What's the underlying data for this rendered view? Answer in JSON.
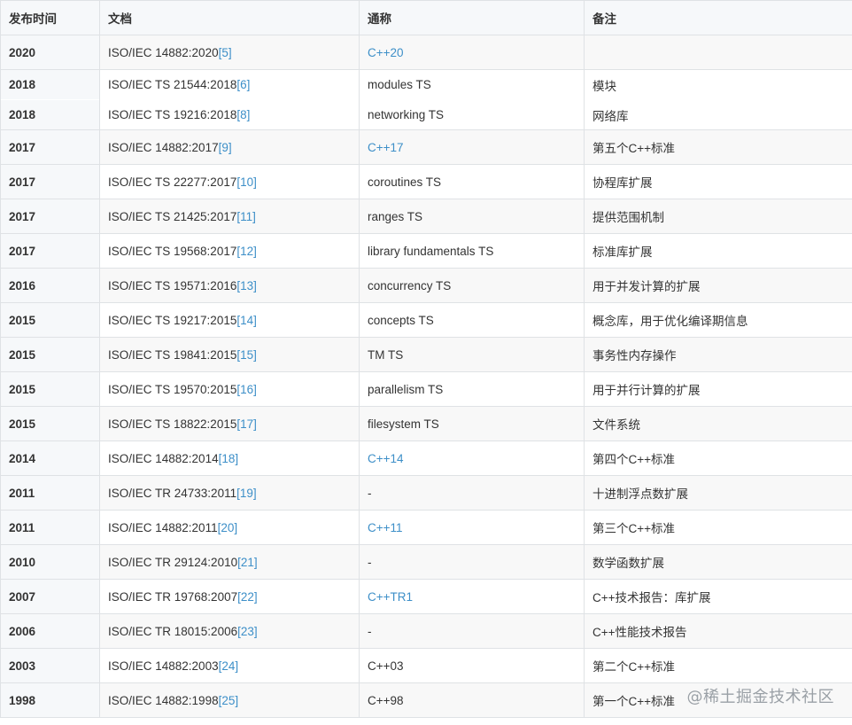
{
  "headers": [
    "发布时间",
    "文档",
    "通称",
    "备注"
  ],
  "rows": [
    {
      "year": "2020",
      "doc": "ISO/IEC 14882:2020",
      "ref": "[5]",
      "name": "C++20",
      "name_link": true,
      "note": ""
    },
    {
      "year": "2018",
      "doc": "ISO/IEC TS 21544:2018",
      "ref": "[6]",
      "name": "modules TS",
      "name_link": false,
      "note": "模块"
    },
    {
      "year": "2018",
      "doc": "ISO/IEC TS 19216:2018",
      "ref": "[8]",
      "name": "networking TS",
      "name_link": false,
      "note": "网络库"
    },
    {
      "year": "2017",
      "doc": "ISO/IEC 14882:2017",
      "ref": "[9]",
      "name": "C++17",
      "name_link": true,
      "note": "第五个C++标准"
    },
    {
      "year": "2017",
      "doc": "ISO/IEC TS 22277:2017",
      "ref": "[10]",
      "name": "coroutines TS",
      "name_link": false,
      "note": "协程库扩展"
    },
    {
      "year": "2017",
      "doc": "ISO/IEC TS 21425:2017",
      "ref": "[11]",
      "name": "ranges TS",
      "name_link": false,
      "note": "提供范围机制"
    },
    {
      "year": "2017",
      "doc": "ISO/IEC TS 19568:2017",
      "ref": "[12]",
      "name": "library fundamentals TS",
      "name_link": false,
      "note": "标准库扩展"
    },
    {
      "year": "2016",
      "doc": "ISO/IEC TS 19571:2016",
      "ref": "[13]",
      "name": "concurrency TS",
      "name_link": false,
      "note": "用于并发计算的扩展"
    },
    {
      "year": "2015",
      "doc": "ISO/IEC TS 19217:2015",
      "ref": "[14]",
      "name": "concepts TS",
      "name_link": false,
      "note": "概念库，用于优化编译期信息"
    },
    {
      "year": "2015",
      "doc": "ISO/IEC TS 19841:2015",
      "ref": "[15]",
      "name": "TM TS",
      "name_link": false,
      "note": "事务性内存操作"
    },
    {
      "year": "2015",
      "doc": "ISO/IEC TS 19570:2015",
      "ref": "[16]",
      "name": "parallelism TS",
      "name_link": false,
      "note": "用于并行计算的扩展"
    },
    {
      "year": "2015",
      "doc": "ISO/IEC TS 18822:2015",
      "ref": "[17]",
      "name": "filesystem TS",
      "name_link": false,
      "note": "文件系统"
    },
    {
      "year": "2014",
      "doc": "ISO/IEC 14882:2014",
      "ref": "[18]",
      "name": "C++14",
      "name_link": true,
      "note": "第四个C++标准"
    },
    {
      "year": "2011",
      "doc": "ISO/IEC TR 24733:2011",
      "ref": "[19]",
      "name": "-",
      "name_link": false,
      "note": "十进制浮点数扩展"
    },
    {
      "year": "2011",
      "doc": "ISO/IEC 14882:2011",
      "ref": "[20]",
      "name": "C++11",
      "name_link": true,
      "note": "第三个C++标准"
    },
    {
      "year": "2010",
      "doc": "ISO/IEC TR 29124:2010",
      "ref": "[21]",
      "name": "-",
      "name_link": false,
      "note": "数学函数扩展"
    },
    {
      "year": "2007",
      "doc": "ISO/IEC TR 19768:2007",
      "ref": "[22]",
      "name": "C++TR1",
      "name_link": true,
      "note": "C++技术报告：库扩展"
    },
    {
      "year": "2006",
      "doc": "ISO/IEC TR 18015:2006",
      "ref": "[23]",
      "name": "-",
      "name_link": false,
      "note": "C++性能技术报告"
    },
    {
      "year": "2003",
      "doc": "ISO/IEC 14882:2003",
      "ref": "[24]",
      "name": "C++03",
      "name_link": false,
      "note": "第二个C++标准"
    },
    {
      "year": "1998",
      "doc": "ISO/IEC 14882:1998",
      "ref": "[25]",
      "name": "C++98",
      "name_link": false,
      "note": "第一个C++标准"
    }
  ],
  "watermark": "@稀土掘金技术社区",
  "colors": {
    "link": "#3d8fc8",
    "header_bg": "#f6f8fa",
    "border": "#dfe2e5"
  }
}
